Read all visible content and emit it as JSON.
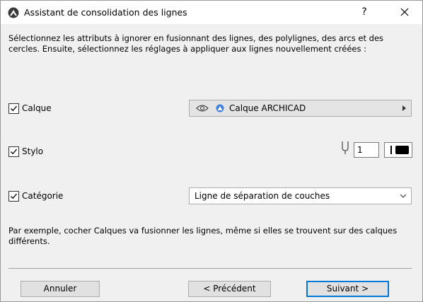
{
  "window": {
    "title": "Assistant de consolidation des lignes",
    "help_label": "?",
    "close_label": "✕",
    "app_icon": "archicad-icon"
  },
  "intro_text": "Sélectionnez les attributs à ignorer en fusionnant des lignes, des polylignes, des arcs et des cercles. Ensuite, sélectionnez les réglages à appliquer aux lignes nouvellement créées :",
  "options": {
    "layer": {
      "label": "Calque",
      "checked": true,
      "value": "Calque ARCHICAD",
      "eye_icon": "eye-icon",
      "layer_icon": "layer-icon"
    },
    "pen": {
      "label": "Stylo",
      "checked": true,
      "pen_number": "1",
      "pen_icon": "pen-icon",
      "swatch_color": "#000000"
    },
    "category": {
      "label": "Catégorie",
      "checked": true,
      "value": "Ligne de séparation de couches"
    }
  },
  "example_text": "Par exemple, cocher Calques va fusionner les lignes, même si elles se trouvent sur des calques différents.",
  "buttons": {
    "cancel": "Annuler",
    "previous": "< Précédent",
    "next": "Suivant >"
  },
  "colors": {
    "dialog_bg": "#f0f0f0",
    "accent": "#0078d7",
    "layer_icon": "#3f7fd8"
  }
}
